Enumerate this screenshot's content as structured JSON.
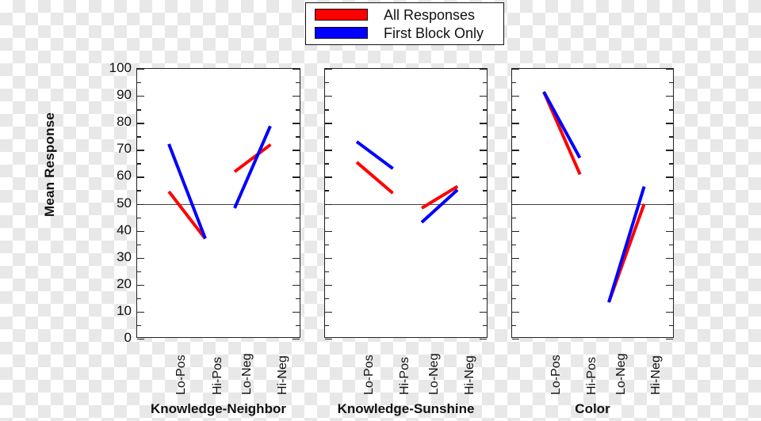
{
  "legend": {
    "items": [
      {
        "label": "All Responses",
        "color": "#ff0000",
        "key": "all_responses"
      },
      {
        "label": "First Block Only",
        "color": "#0000ff",
        "key": "first_block_only"
      }
    ]
  },
  "axis": {
    "ylabel": "Mean Response",
    "yticks": [
      "0",
      "10",
      "20",
      "30",
      "40",
      "50",
      "60",
      "70",
      "80",
      "90",
      "100"
    ]
  },
  "chart_data": {
    "type": "line",
    "title": "",
    "xlabel": "",
    "ylabel": "Mean Response",
    "ylim": [
      0,
      100
    ],
    "ytick_step": 10,
    "grid": false,
    "reference_line": 50,
    "legend_position": "top-center",
    "categories": [
      "Lo-Pos",
      "Hi-Pos",
      "Lo-Neg",
      "Hi-Neg"
    ],
    "panels": [
      {
        "name": "Knowledge-Neighbor",
        "series": [
          {
            "name": "All Responses",
            "color": "#ff0000",
            "values": [
              54.5,
              37.0,
              62.0,
              72.0
            ]
          },
          {
            "name": "First Block Only",
            "color": "#0000ff",
            "values": [
              72.0,
              37.0,
              48.5,
              79.0
            ]
          }
        ]
      },
      {
        "name": "Knowledge-Sunshine",
        "series": [
          {
            "name": "All Responses",
            "color": "#ff0000",
            "values": [
              65.5,
              54.0,
              48.5,
              56.5
            ]
          },
          {
            "name": "First Block Only",
            "color": "#0000ff",
            "values": [
              73.0,
              63.0,
              43.0,
              55.0
            ]
          }
        ]
      },
      {
        "name": "Color",
        "series": [
          {
            "name": "All Responses",
            "color": "#ff0000",
            "values": [
              91.5,
              61.0,
              13.5,
              50.0
            ]
          },
          {
            "name": "First Block Only",
            "color": "#0000ff",
            "values": [
              91.5,
              67.0,
              13.5,
              56.5
            ]
          }
        ]
      }
    ]
  }
}
